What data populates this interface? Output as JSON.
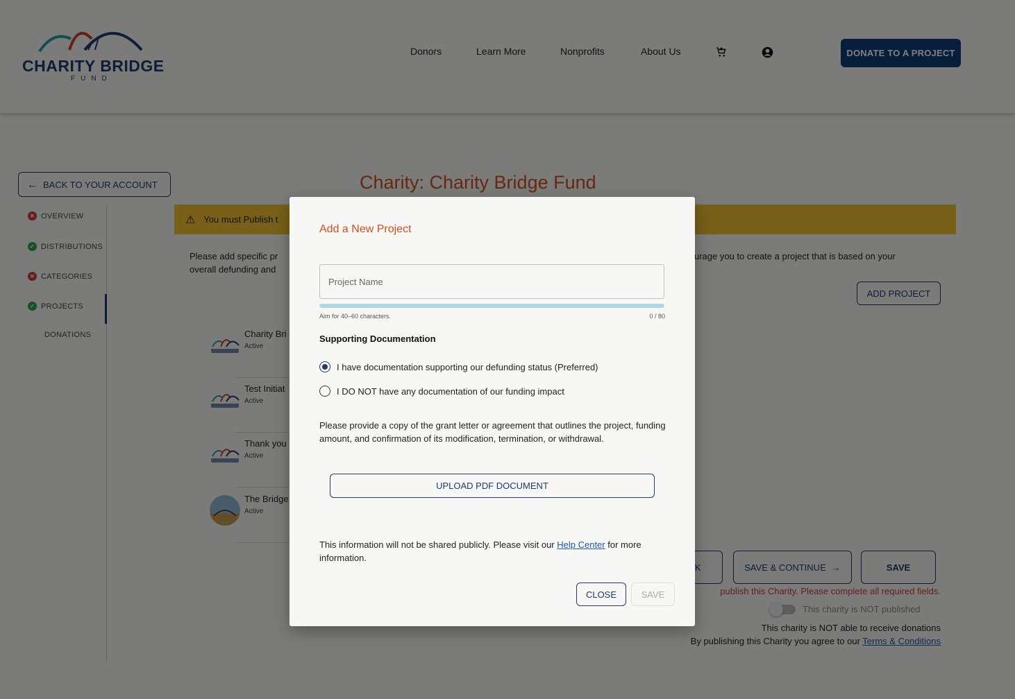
{
  "header": {
    "logo_text": "CHARITY BRIDGE",
    "logo_sub": "FUND",
    "nav": [
      "Donors",
      "Learn More",
      "Nonprofits",
      "About Us"
    ],
    "cart_icon": "cart-icon",
    "account_icon": "account-circle-icon",
    "donate_label": "DONATE TO A PROJECT"
  },
  "sidebar": {
    "back_label": "BACK TO YOUR ACCOUNT",
    "items": [
      {
        "label": "OVERVIEW",
        "status": "error"
      },
      {
        "label": "DISTRIBUTIONS",
        "status": "complete"
      },
      {
        "label": "CATEGORIES",
        "status": "error"
      },
      {
        "label": "PROJECTS",
        "status": "complete"
      },
      {
        "label": "DONATIONS",
        "status": "none"
      }
    ]
  },
  "main": {
    "title": "Charity: Charity Bridge Fund",
    "warning": "You must Publish t",
    "intro_left": "Please add specific pr",
    "intro_left2": "overall defunding and",
    "intro_right": "urage you to create a project that is based on your",
    "add_project_label": "ADD PROJECT",
    "projects": [
      {
        "name": "Charity Bri",
        "status": "Active"
      },
      {
        "name": "Test Initiat",
        "status": "Active"
      },
      {
        "name": "Thank you",
        "status": "Active"
      },
      {
        "name": "The Bridge",
        "status": "Active"
      }
    ],
    "back_label": "CK",
    "save_continue_label": "SAVE & CONTINUE",
    "save_label": "SAVE",
    "error_text": "publish this Charity. Please complete all required fields.",
    "toggle_label": "This charity is NOT published",
    "not_able": "This charity is NOT able to receive donations",
    "agree_prefix": "By publishing this Charity you agree to our ",
    "agree_link": "Terms & Conditions"
  },
  "modal": {
    "title": "Add a New Project",
    "name_placeholder": "Project Name",
    "name_value": "",
    "progress": 0,
    "hint": "Aim for 40–60 characters.",
    "counter": "0 / 80",
    "support_label": "Supporting Documentation",
    "radio_options": [
      {
        "label": "I have documentation supporting our defunding status (Preferred)",
        "checked": true
      },
      {
        "label": "I DO NOT have any documentation of our funding impact",
        "checked": false
      }
    ],
    "description": "Please provide a copy of the grant letter or agreement that outlines the project, funding amount, and confirmation of its modification, termination, or withdrawal.",
    "upload_label": "UPLOAD PDF DOCUMENT",
    "privacy_prefix": "This information will not be shared publicly. Please visit our ",
    "privacy_link": "Help Center",
    "privacy_suffix": " for more information.",
    "close_label": "CLOSE",
    "save_label": "SAVE"
  },
  "colors": {
    "brand": "#1e3a6e",
    "accent": "#d0501f",
    "warning": "#f2c031",
    "error": "#d13b3b",
    "success": "#2f9e4f"
  }
}
